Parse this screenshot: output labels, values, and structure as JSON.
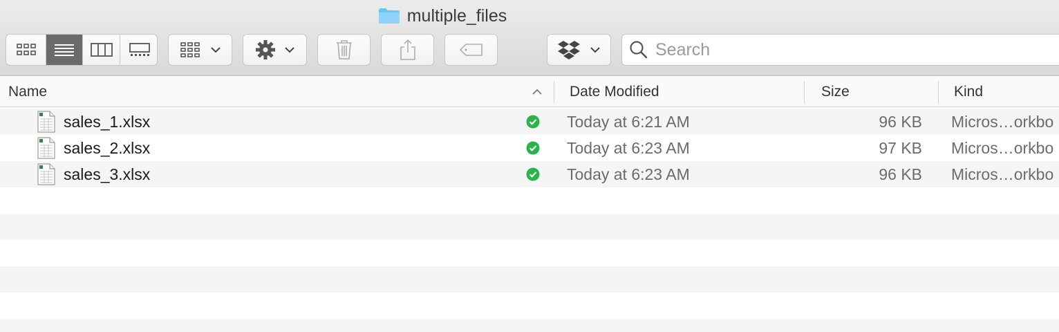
{
  "window": {
    "title": "multiple_files"
  },
  "toolbar": {
    "view_modes": [
      {
        "name": "icon-view",
        "icon": "grid-icon",
        "active": false
      },
      {
        "name": "list-view",
        "icon": "list-icon",
        "active": true
      },
      {
        "name": "column-view",
        "icon": "columns-icon",
        "active": false
      },
      {
        "name": "gallery-view",
        "icon": "gallery-icon",
        "active": false
      }
    ],
    "group_button_icon": "group-grid-icon",
    "action_button_icon": "gear-icon",
    "trash_button_icon": "trash-icon",
    "share_button_icon": "share-icon",
    "tag_button_icon": "tag-icon",
    "dropbox_button_icon": "dropbox-icon"
  },
  "search": {
    "placeholder": "Search",
    "value": ""
  },
  "columns": {
    "name": "Name",
    "date_modified": "Date Modified",
    "size": "Size",
    "kind": "Kind"
  },
  "files": [
    {
      "name": "sales_1.xlsx",
      "date": "Today at 6:21 AM",
      "size": "96 KB",
      "kind": "Micros…orkbo",
      "status": "synced"
    },
    {
      "name": "sales_2.xlsx",
      "date": "Today at 6:23 AM",
      "size": "97 KB",
      "kind": "Micros…orkbo",
      "status": "synced"
    },
    {
      "name": "sales_3.xlsx",
      "date": "Today at 6:23 AM",
      "size": "96 KB",
      "kind": "Micros…orkbo",
      "status": "synced"
    }
  ],
  "colors": {
    "synced": "#2bb24a",
    "folder": "#6cc3f5",
    "active_segment": "#6a6a6a"
  }
}
